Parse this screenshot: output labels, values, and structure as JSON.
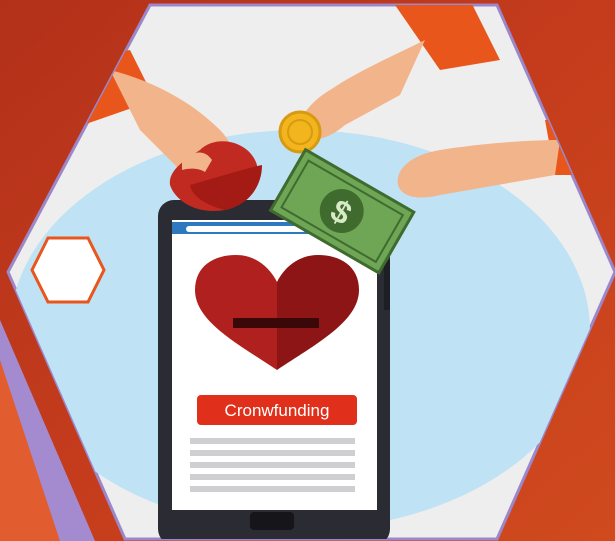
{
  "scene": {
    "screen_label": "Cronwfunding",
    "colors": {
      "background_red": "#c0391c",
      "accent_orange": "#e8561c",
      "hex_border": "#9b87c9",
      "light_blue": "#bfe2f5",
      "phone_body": "#2b2b33",
      "heart_red": "#b0201e",
      "money_green": "#6fa656",
      "coin_gold": "#f2b51e",
      "skin": "#f2b48a"
    },
    "icons": [
      "heart-icon",
      "coin-icon",
      "dollar-bill-icon",
      "smartphone-icon",
      "hexagon-badge-icon"
    ]
  }
}
